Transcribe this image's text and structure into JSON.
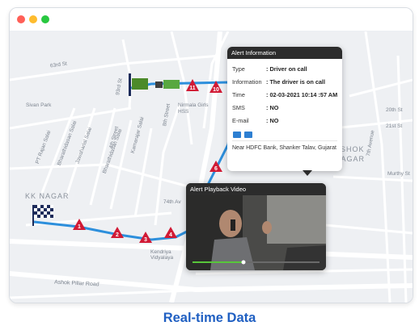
{
  "window": {
    "buttons": [
      {
        "name": "close",
        "color": "#ff5f57"
      },
      {
        "name": "minimize",
        "color": "#febc2e"
      },
      {
        "name": "maximize",
        "color": "#28c840"
      }
    ]
  },
  "map": {
    "area_labels": [
      "KK NAGAR",
      "ASHOK",
      "NAGAR"
    ],
    "streets": [
      "63rd St",
      "Sivan Park",
      "PT Rajan Salai",
      "Bharathidasan Salai",
      "Jawaharlal Salai",
      "Bharathidasan Salai",
      "Kamarajar Salai",
      "4th Street",
      "Nirmala Girls HSS",
      "8th Street",
      "93rd St",
      "74th Av",
      "Kendriya Vidyalaya",
      "Ashok Pillar Road",
      "20th St",
      "21st St",
      "7th Avenue",
      "Murthy St",
      "Rd"
    ],
    "route_markers": [
      "1",
      "2",
      "3",
      "4",
      "6",
      "10",
      "11"
    ],
    "route_color": "#2d8fdc",
    "marker_color": "#d11a35"
  },
  "alert_info": {
    "title": "Alert Information",
    "rows": [
      {
        "key": "Type",
        "value": ": Driver on call"
      },
      {
        "key": "Information",
        "value": ": The driver is on call"
      },
      {
        "key": "Time",
        "value": ": 02-03-2021 10:14 :57 AM"
      },
      {
        "key": "SMS",
        "value": ": NO"
      },
      {
        "key": "E-mail",
        "value": ": NO"
      }
    ],
    "address": "Near HDFC Bank, Shanker Talav, Gujarat",
    "action_icons": [
      "share-icon",
      "download-icon"
    ]
  },
  "video": {
    "title": "Alert Playback Video",
    "progress": 0.4
  },
  "caption": "Real-time Data"
}
